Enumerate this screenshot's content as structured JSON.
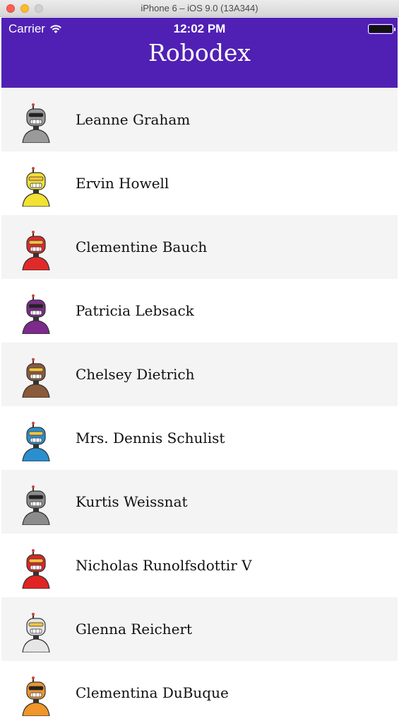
{
  "window": {
    "title": "iPhone 6 – iOS 9.0 (13A344)"
  },
  "status_bar": {
    "carrier": "Carrier",
    "time": "12:02 PM"
  },
  "nav": {
    "title": "Robodex",
    "background": "#5020b4"
  },
  "robots": [
    {
      "name": "Leanne Graham",
      "color": "#9a9a9a",
      "icon": "robot-avatar-gray"
    },
    {
      "name": "Ervin Howell",
      "color": "#f1e234",
      "icon": "robot-avatar-yellow"
    },
    {
      "name": "Clementine Bauch",
      "color": "#e02a2a",
      "icon": "robot-avatar-red"
    },
    {
      "name": "Patricia Lebsack",
      "color": "#7d2a8c",
      "icon": "robot-avatar-purple"
    },
    {
      "name": "Chelsey Dietrich",
      "color": "#8a5a3a",
      "icon": "robot-avatar-brown"
    },
    {
      "name": "Mrs. Dennis Schulist",
      "color": "#2a8fd0",
      "icon": "robot-avatar-blue"
    },
    {
      "name": "Kurtis Weissnat",
      "color": "#8c8c8c",
      "icon": "robot-avatar-gray"
    },
    {
      "name": "Nicholas Runolfsdottir V",
      "color": "#e02424",
      "icon": "robot-avatar-red"
    },
    {
      "name": "Glenna Reichert",
      "color": "#e6e6e6",
      "icon": "robot-avatar-white"
    },
    {
      "name": "Clementina DuBuque",
      "color": "#f0962a",
      "icon": "robot-avatar-orange"
    }
  ]
}
